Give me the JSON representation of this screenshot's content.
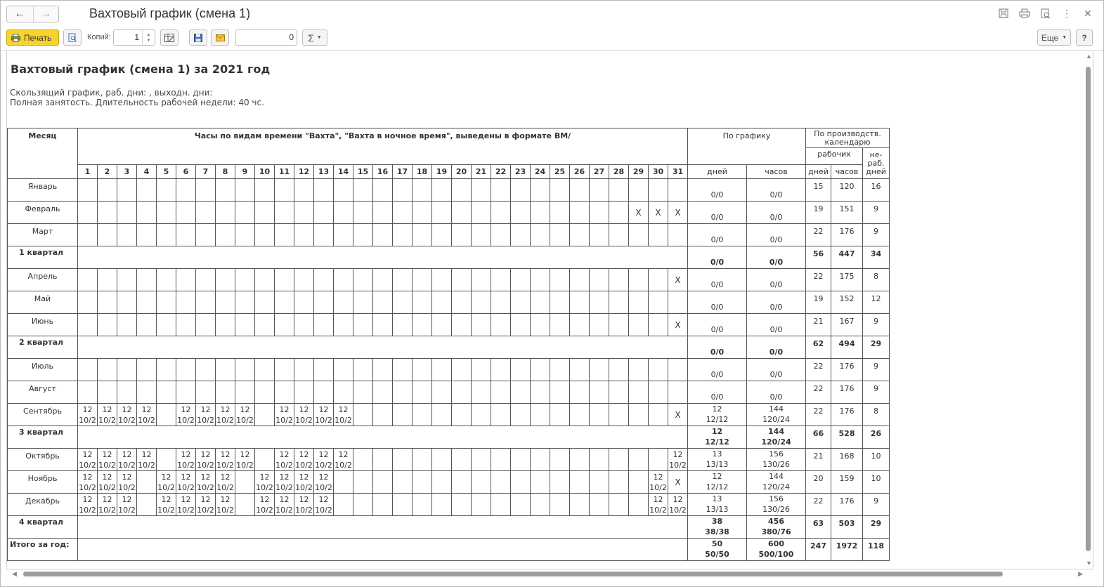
{
  "window": {
    "title": "Вахтовый график (смена 1)"
  },
  "toolbar": {
    "print_label": "Печать",
    "copies_label": "Копий:",
    "copies_value": "1",
    "sum_value": "0",
    "sigma": "Σ",
    "more_label": "Еще",
    "help_label": "?"
  },
  "report": {
    "title": "Вахтовый график (смена 1)  за 2021 год",
    "line1": "Скользящий график, раб. дни: , выходн. дни:",
    "line2": "Полная занятость. Длительность рабочей недели: 40 чс."
  },
  "header": {
    "month": "Месяц",
    "main": "Часы по видам времени \"Вахта\", \"Вахта в ночное время\", выведены в формате ВМ/",
    "schedule": "По графику",
    "calendar": "По производств. календарю",
    "workers": "рабочих",
    "nonwork": "не-раб. дней",
    "days": "дней",
    "hours": "часов",
    "cal_days": "дней",
    "cal_hours": "часов",
    "day_numbers": [
      "1",
      "2",
      "3",
      "4",
      "5",
      "6",
      "7",
      "8",
      "9",
      "10",
      "11",
      "12",
      "13",
      "14",
      "15",
      "16",
      "17",
      "18",
      "19",
      "20",
      "21",
      "22",
      "23",
      "24",
      "25",
      "26",
      "27",
      "28",
      "29",
      "30",
      "31"
    ]
  },
  "rows": [
    {
      "type": "m",
      "label": "Январь",
      "days": {},
      "sched_days": "0/0",
      "sched_hours": "0/0",
      "cal": [
        "15",
        "120",
        "16"
      ]
    },
    {
      "type": "m",
      "label": "Февраль",
      "days": {
        "29": "X",
        "30": "X",
        "31": "X"
      },
      "sched_days": "0/0",
      "sched_hours": "0/0",
      "cal": [
        "19",
        "151",
        "9"
      ]
    },
    {
      "type": "m",
      "label": "Март",
      "days": {},
      "sched_days": "0/0",
      "sched_hours": "0/0",
      "cal": [
        "22",
        "176",
        "9"
      ]
    },
    {
      "type": "q",
      "label": "1 квартал",
      "sched_days": "0/0",
      "sched_hours": "0/0",
      "cal": [
        "56",
        "447",
        "34"
      ]
    },
    {
      "type": "m",
      "label": "Апрель",
      "days": {
        "31": "X"
      },
      "sched_days": "0/0",
      "sched_hours": "0/0",
      "cal": [
        "22",
        "175",
        "8"
      ]
    },
    {
      "type": "m",
      "label": "Май",
      "days": {},
      "sched_days": "0/0",
      "sched_hours": "0/0",
      "cal": [
        "19",
        "152",
        "12"
      ]
    },
    {
      "type": "m",
      "label": "Июнь",
      "days": {
        "31": "X"
      },
      "sched_days": "0/0",
      "sched_hours": "0/0",
      "cal": [
        "21",
        "167",
        "9"
      ]
    },
    {
      "type": "q",
      "label": "2 квартал",
      "sched_days": "0/0",
      "sched_hours": "0/0",
      "cal": [
        "62",
        "494",
        "29"
      ]
    },
    {
      "type": "m",
      "label": "Июль",
      "days": {},
      "sched_days": "0/0",
      "sched_hours": "0/0",
      "cal": [
        "22",
        "176",
        "9"
      ]
    },
    {
      "type": "m",
      "label": "Август",
      "days": {},
      "sched_days": "0/0",
      "sched_hours": "0/0",
      "cal": [
        "22",
        "176",
        "9"
      ]
    },
    {
      "type": "m",
      "label": "Сентябрь",
      "days": {
        "1": "12|10/2",
        "2": "12|10/2",
        "3": "12|10/2",
        "4": "12|10/2",
        "6": "12|10/2",
        "7": "12|10/2",
        "8": "12|10/2",
        "9": "12|10/2",
        "11": "12|10/2",
        "12": "12|10/2",
        "13": "12|10/2",
        "14": "12|10/2",
        "31": "X"
      },
      "sched_days": "12|12/12",
      "sched_hours": "144|120/24",
      "cal": [
        "22",
        "176",
        "8"
      ]
    },
    {
      "type": "q",
      "label": "3 квартал",
      "sched_days": "12|12/12",
      "sched_hours": "144|120/24",
      "cal": [
        "66",
        "528",
        "26"
      ]
    },
    {
      "type": "m",
      "label": "Октябрь",
      "days": {
        "1": "12|10/2",
        "2": "12|10/2",
        "3": "12|10/2",
        "4": "12|10/2",
        "6": "12|10/2",
        "7": "12|10/2",
        "8": "12|10/2",
        "9": "12|10/2",
        "11": "12|10/2",
        "12": "12|10/2",
        "13": "12|10/2",
        "14": "12|10/2",
        "31": "12|10/2"
      },
      "sched_days": "13|13/13",
      "sched_hours": "156|130/26",
      "cal": [
        "21",
        "168",
        "10"
      ]
    },
    {
      "type": "m",
      "label": "Ноябрь",
      "days": {
        "1": "12|10/2",
        "2": "12|10/2",
        "3": "12|10/2",
        "5": "12|10/2",
        "6": "12|10/2",
        "7": "12|10/2",
        "8": "12|10/2",
        "10": "12|10/2",
        "11": "12|10/2",
        "12": "12|10/2",
        "13": "12|10/2",
        "30": "12|10/2",
        "31": "X"
      },
      "sched_days": "12|12/12",
      "sched_hours": "144|120/24",
      "cal": [
        "20",
        "159",
        "10"
      ]
    },
    {
      "type": "m",
      "label": "Декабрь",
      "days": {
        "1": "12|10/2",
        "2": "12|10/2",
        "3": "12|10/2",
        "5": "12|10/2",
        "6": "12|10/2",
        "7": "12|10/2",
        "8": "12|10/2",
        "10": "12|10/2",
        "11": "12|10/2",
        "12": "12|10/2",
        "13": "12|10/2",
        "30": "12|10/2",
        "31": "12|10/2"
      },
      "sched_days": "13|13/13",
      "sched_hours": "156|130/26",
      "cal": [
        "22",
        "176",
        "9"
      ]
    },
    {
      "type": "q",
      "label": "4 квартал",
      "sched_days": "38|38/38",
      "sched_hours": "456|380/76",
      "cal": [
        "63",
        "503",
        "29"
      ]
    },
    {
      "type": "t",
      "label": "Итого за год:",
      "sched_days": "50|50/50",
      "sched_hours": "600|500/100",
      "cal": [
        "247",
        "1972",
        "118"
      ]
    }
  ]
}
